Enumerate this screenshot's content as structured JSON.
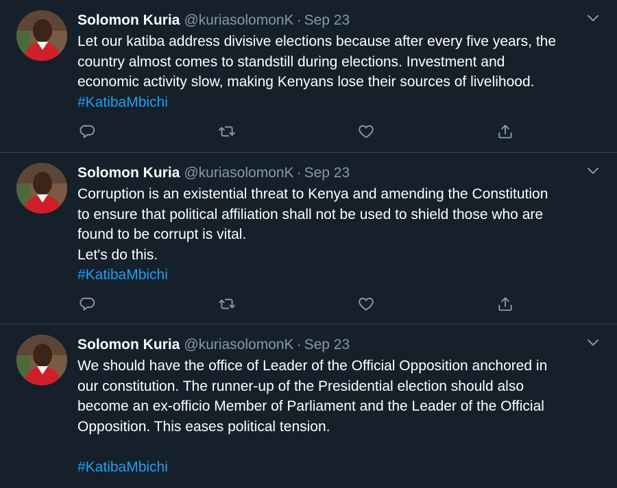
{
  "tweets": [
    {
      "author_name": "Solomon Kuria",
      "handle": "@kuriasolomonK",
      "separator": "·",
      "date": "Sep 23",
      "lines": [
        "Let our katiba address divisive elections because after every five years, the",
        "country almost comes to standstill during elections. Investment and",
        "economic activity slow, making Kenyans lose their sources of livelihood."
      ],
      "hashtag": "#KatibaMbichi"
    },
    {
      "author_name": "Solomon Kuria",
      "handle": "@kuriasolomonK",
      "separator": "·",
      "date": "Sep 23",
      "lines": [
        "Corruption is an existential threat to Kenya and amending the Constitution",
        "to ensure that political affiliation shall not be used to shield those who are",
        "found to be corrupt is vital.",
        "Let's do this."
      ],
      "hashtag": "#KatibaMbichi"
    },
    {
      "author_name": "Solomon Kuria",
      "handle": "@kuriasolomonK",
      "separator": "·",
      "date": "Sep 23",
      "lines": [
        "We should have the office of Leader of the Official Opposition anchored in",
        "our constitution. The runner-up of the Presidential election should also",
        "become an ex-officio Member of Parliament and the Leader of the Official",
        "Opposition. This eases political tension."
      ],
      "hashtag": "#KatibaMbichi"
    }
  ],
  "icons": {
    "more": "chevron-down-icon",
    "reply": "reply-icon",
    "retweet": "retweet-icon",
    "like": "heart-icon",
    "share": "share-icon"
  },
  "colors": {
    "background": "#15202b",
    "divider": "#38444d",
    "secondary_text": "#8899a6",
    "hashtag": "#1da1f2",
    "text": "#ffffff"
  }
}
